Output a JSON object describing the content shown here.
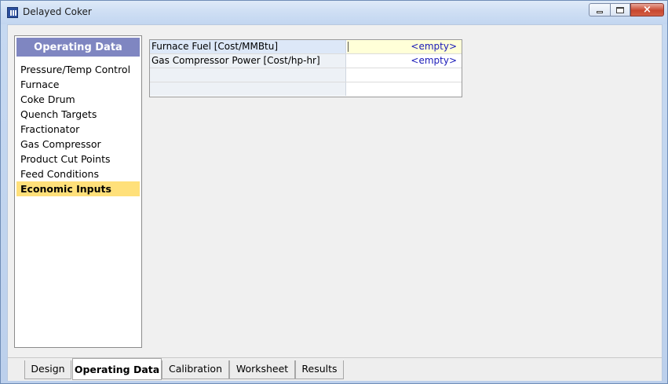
{
  "window": {
    "title": "Delayed Coker",
    "controls": {
      "minimize": "minimize",
      "maximize": "maximize",
      "close": "×"
    }
  },
  "nav": {
    "header": "Operating Data",
    "items": [
      {
        "label": "Pressure/Temp Control",
        "selected": false
      },
      {
        "label": "Furnace",
        "selected": false
      },
      {
        "label": "Coke Drum",
        "selected": false
      },
      {
        "label": "Quench Targets",
        "selected": false
      },
      {
        "label": "Fractionator",
        "selected": false
      },
      {
        "label": "Gas Compressor",
        "selected": false
      },
      {
        "label": "Product Cut Points",
        "selected": false
      },
      {
        "label": "Feed Conditions",
        "selected": false
      },
      {
        "label": "Economic Inputs",
        "selected": true
      }
    ]
  },
  "grid": {
    "rows": [
      {
        "label": "Furnace Fuel [Cost/MMBtu]",
        "value": "<empty>"
      },
      {
        "label": "Gas Compressor Power [Cost/hp-hr]",
        "value": "<empty>"
      },
      {
        "label": "",
        "value": ""
      },
      {
        "label": "",
        "value": ""
      }
    ]
  },
  "tabs": [
    {
      "label": "Design",
      "active": false
    },
    {
      "label": "Operating Data",
      "active": true
    },
    {
      "label": "Calibration",
      "active": false
    },
    {
      "label": "Worksheet",
      "active": false
    },
    {
      "label": "Results",
      "active": false
    }
  ],
  "colors": {
    "nav_header_bg": "#7f86c1",
    "selected_item_bg": "#ffe07a",
    "empty_value_text": "#1a1ab8",
    "active_cell_bg": "#ffffd8"
  }
}
